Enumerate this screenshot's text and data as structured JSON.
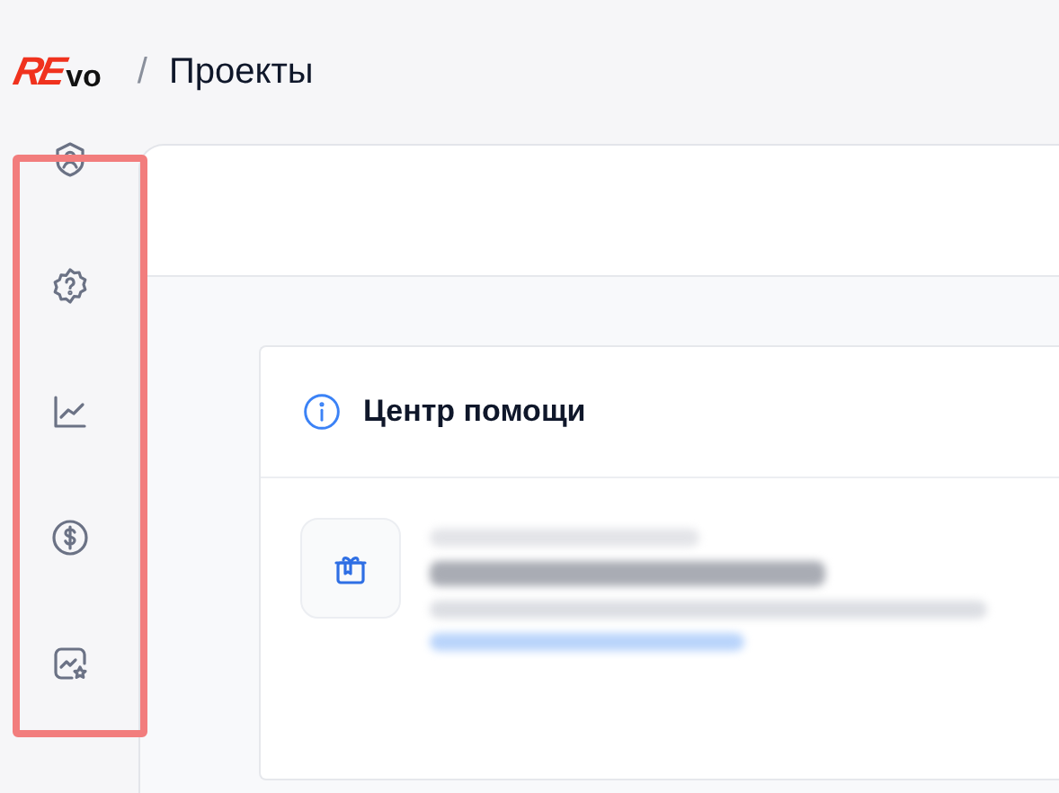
{
  "header": {
    "logo": {
      "accent": "RE",
      "rest": "vo"
    },
    "separator": "/",
    "title": "Проекты"
  },
  "sidebar": {
    "highlighted": true,
    "items": [
      {
        "kind": "profile-shield"
      },
      {
        "kind": "help-badge"
      },
      {
        "kind": "chart"
      },
      {
        "kind": "dollar"
      },
      {
        "kind": "chart-star"
      }
    ]
  },
  "help_center": {
    "title": "Центр помощи",
    "items": [
      {
        "kind": "gift"
      }
    ]
  }
}
